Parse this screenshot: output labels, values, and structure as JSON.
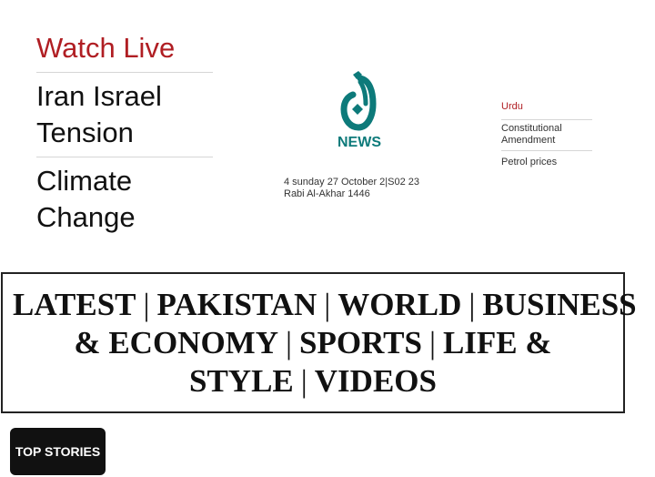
{
  "left_links": {
    "watch_live": "Watch Live",
    "iran_israel": "Iran Israel Tension",
    "climate": "Climate Change"
  },
  "logo": {
    "text": "NEWS",
    "icon": "aaj-logo-icon",
    "color": "#0d7a7a"
  },
  "date": {
    "line1": "4 sunday 27 October 2|S02 23",
    "line2": "Rabi Al-Akhar 1446"
  },
  "right_links": {
    "urdu": "Urdu",
    "constitutional": "Constitutional Amendment",
    "petrol": "Petrol prices"
  },
  "nav": {
    "latest": "LATEST",
    "pakistan": "PAKISTAN",
    "world": "WORLD",
    "business": "BUSINESS & ECONOMY",
    "sports": "SPORTS",
    "life": "LIFE & STYLE",
    "videos": "VIDEOS",
    "separator": "|"
  },
  "top_stories_label": "TOP STORIES",
  "colors": {
    "accent_red": "#b01e23",
    "logo_teal": "#0d7a7a"
  }
}
